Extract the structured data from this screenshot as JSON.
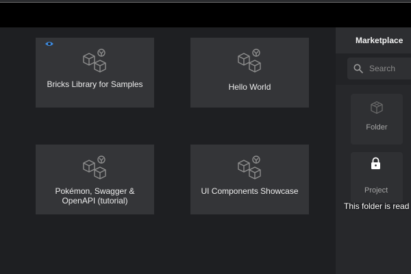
{
  "projects": [
    {
      "title": "Bricks Library for Samples",
      "watched": true
    },
    {
      "title": "Hello World",
      "watched": false
    },
    {
      "title": "Pokémon, Swagger & OpenAPI (tutorial)",
      "watched": false
    },
    {
      "title": "UI Components Showcase",
      "watched": false
    }
  ],
  "sidebar": {
    "title": "Marketplace",
    "search_placeholder": "Search",
    "folder_label": "Folder",
    "project_label": "Project",
    "readonly_message": "This folder is read"
  },
  "icons": {
    "card": "cubes-icon",
    "watch": "eye-icon",
    "search": "search-icon",
    "folder": "cube-icon",
    "locked": "lock-icon"
  },
  "colors": {
    "accent": "#3d8be0"
  }
}
